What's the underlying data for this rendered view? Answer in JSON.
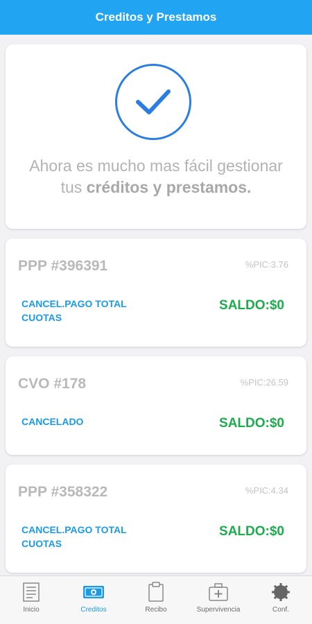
{
  "header": {
    "title": "Creditos y Prestamos"
  },
  "hero": {
    "text_plain": "Ahora es mucho mas fácil gestionar tus ",
    "text_bold": "créditos y prestamos."
  },
  "loans": [
    {
      "code": "PPP #396391",
      "pic": "%PIC:3.76",
      "status": "CANCEL.PAGO TOTAL CUOTAS",
      "saldo": "SALDO:$0"
    },
    {
      "code": "CVO #178",
      "pic": "%PIC:26.59",
      "status": "CANCELADO",
      "saldo": "SALDO:$0"
    },
    {
      "code": "PPP #358322",
      "pic": "%PIC:4.34",
      "status": "CANCEL.PAGO TOTAL CUOTAS",
      "saldo": "SALDO:$0"
    }
  ],
  "tabs": [
    {
      "label": "Inicio",
      "icon": "document-icon",
      "active": false
    },
    {
      "label": "Creditos",
      "icon": "money-icon",
      "active": true
    },
    {
      "label": "Recibo",
      "icon": "clipboard-icon",
      "active": false
    },
    {
      "label": "Supervivencia",
      "icon": "medical-kit-icon",
      "active": false
    },
    {
      "label": "Conf.",
      "icon": "gear-icon",
      "active": false
    }
  ],
  "colors": {
    "header": "#21a5f3",
    "status": "#1a9be8",
    "saldo": "#1bad4b",
    "check": "#2a7de1"
  }
}
